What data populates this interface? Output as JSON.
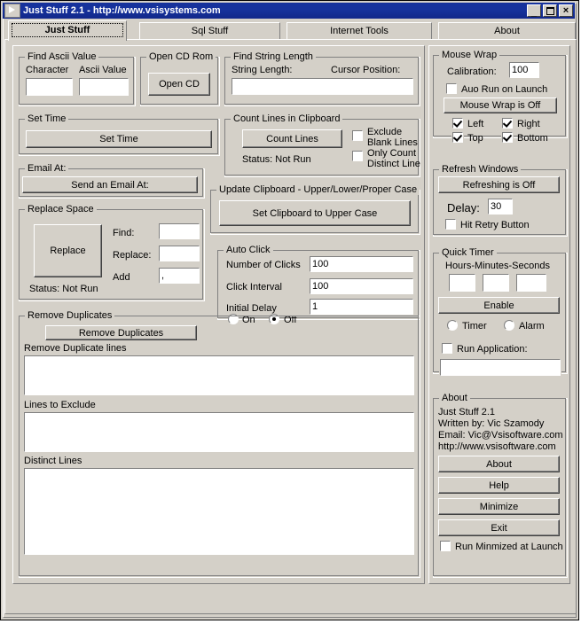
{
  "window": {
    "title": "Just Stuff 2.1 - http://www.vsisystems.com",
    "icon": "play-triangle-icon",
    "minimize": "_",
    "maximize": "",
    "close": "×"
  },
  "tabs": [
    {
      "label": "Just Stuff",
      "active": true
    },
    {
      "label": "Sql Stuff",
      "active": false
    },
    {
      "label": "Internet Tools",
      "active": false
    },
    {
      "label": "About",
      "active": false
    }
  ],
  "find_ascii": {
    "caption": "Find Ascii Value",
    "character_label": "Character",
    "ascii_label": "Ascii Value",
    "character_value": "",
    "ascii_value": ""
  },
  "open_cd": {
    "caption": "Open CD Rom",
    "button": "Open CD",
    "button_accel": "O"
  },
  "find_string_length": {
    "caption": "Find String Length",
    "string_length_label": "String Length:",
    "cursor_position_label": "Cursor Position:",
    "value": ""
  },
  "mouse_wrap": {
    "caption": "Mouse Wrap",
    "calibration_label": "Calibration:",
    "calibration_value": "100",
    "auto_run_label": "Auo Run on Launch",
    "auto_run_checked": false,
    "toggle_button": "Mouse Wrap is Off",
    "left_label": "Left",
    "left_checked": true,
    "right_label": "Right",
    "right_checked": true,
    "top_label": "Top",
    "top_checked": true,
    "bottom_label": "Bottom",
    "bottom_checked": true
  },
  "set_time": {
    "caption": "Set Time",
    "button": "Set Time",
    "button_accel": "T"
  },
  "count_lines": {
    "caption": "Count Lines in Clipboard",
    "button": "Count Lines",
    "button_accel": "C",
    "status": "Status: Not Run",
    "exclude_blank_label": "Exclude Blank Lines",
    "exclude_blank_checked": false,
    "distinct_only_label": "Only Count Distinct Line",
    "distinct_only_checked": false
  },
  "refresh_windows": {
    "caption": "Refresh Windows",
    "toggle_button": "Refreshing is Off",
    "toggle_accel": "O",
    "delay_label": "Delay:",
    "delay_value": "30",
    "retry_label": "Hit Retry Button",
    "retry_checked": false
  },
  "email": {
    "caption": "Email At:",
    "button": "Send an Email At:"
  },
  "update_clipboard": {
    "caption": "Update Clipboard - Upper/Lower/Proper Case",
    "button": "Set Clipboard to Upper Case",
    "button_accel": "S"
  },
  "replace_space": {
    "caption": "Replace Space",
    "button": "Replace",
    "button_accel": "R",
    "find_label": "Find:",
    "find_value": "",
    "replace_label": "Replace:",
    "replace_value": "",
    "add_label": "Add",
    "add_value": ",",
    "status": "Status: Not Run"
  },
  "auto_click": {
    "caption": "Auto Click",
    "number_label": "Number of Clicks",
    "number_value": "100",
    "interval_label": "Click Interval",
    "interval_value": "100",
    "delay_label": "Initial Delay",
    "delay_value": "1",
    "on_label": "On",
    "off_label": "Off",
    "selected": "Off"
  },
  "quick_timer": {
    "caption": "Quick Timer",
    "hms_label": "Hours-Minutes-Seconds",
    "hours_value": "",
    "minutes_value": "",
    "seconds_value": "",
    "enable_button": "Enable",
    "timer_label": "Timer",
    "alarm_label": "Alarm",
    "selected": "",
    "run_app_label": "Run Application:",
    "run_app_checked": false,
    "run_app_value": ""
  },
  "remove_duplicates": {
    "caption": "Remove Duplicates",
    "button": "Remove Duplicates",
    "dup_lines_label": "Remove Duplicate lines",
    "dup_lines_value": "",
    "exclude_label": "Lines to Exclude",
    "exclude_value": "",
    "distinct_label": "Distinct Lines",
    "distinct_value": ""
  },
  "about": {
    "caption": "About",
    "line1": "Just Stuff 2.1",
    "line2": "Written by: Vic Szamody",
    "line3": "Email: Vic@Vsisoftware.com",
    "line4": "http://www.vsisoftware.com",
    "about_button": "About",
    "about_accel": "A",
    "help_button": "Help",
    "help_accel": "H",
    "minimize_button": "Minimize",
    "minimize_accel": "z",
    "exit_button": "Exit",
    "exit_accel": "x",
    "run_minimized_label": "Run Minmized at Launch",
    "run_minimized_checked": false
  },
  "colors": {
    "titlebar": "#16329c",
    "face": "#d4d0c8",
    "shadow": "#808080",
    "highlight": "#ffffff",
    "field": "#ffffff"
  }
}
